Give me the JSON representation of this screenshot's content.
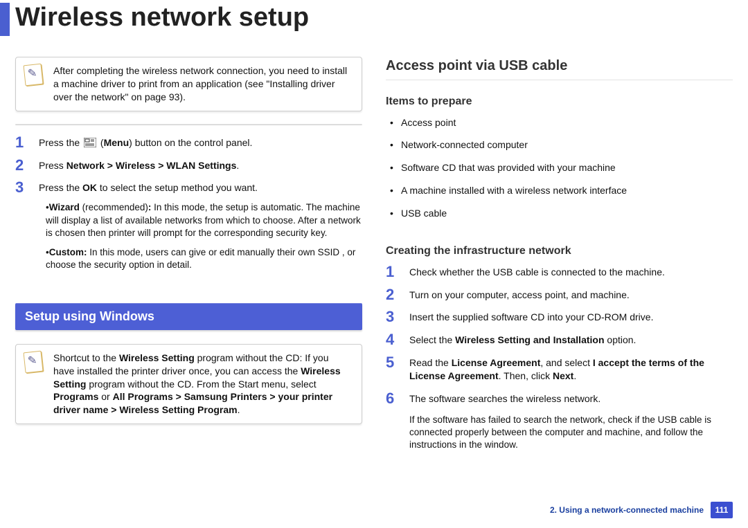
{
  "header": {
    "title": "Wireless network setup"
  },
  "left": {
    "note1": "After completing the wireless network connection, you need to install a machine driver to print from an application (see \"Installing driver over the network\" on page 93).",
    "steps": {
      "s1_a": "Press the ",
      "s1_b": " (",
      "s1_menu": "Menu",
      "s1_c": ") button on the control panel.",
      "s2_a": "Press ",
      "s2_path": "Network > Wireless > WLAN Settings",
      "s2_b": ".",
      "s3_a": "Press the ",
      "s3_ok": "OK",
      "s3_b": " to select the setup method you want.",
      "wizard_label": "Wizard",
      "wizard_rec": " (recommended)",
      "wizard_colon": ": ",
      "wizard_body": "In this mode, the setup is automatic. The machine will display a list of available networks from which to choose. After a network is chosen then printer will prompt for the corresponding security key.",
      "custom_label": "Custom:",
      "custom_body": " In this mode, users can give or edit manually their own SSID , or choose the security option in detail."
    },
    "section_bar": "Setup using Windows",
    "note2_a": "Shortcut to the ",
    "note2_ws1": "Wireless Setting",
    "note2_b": " program without the CD: If you have installed the printer driver once, you can access the ",
    "note2_ws2": "Wireless Setting",
    "note2_c": " program without the CD. From the Start menu, select ",
    "note2_programs": "Programs",
    "note2_or": " or ",
    "note2_allprograms": "All Programs",
    "note2_gt1": " > ",
    "note2_sp": "Samsung Printers",
    "note2_gt2": " > ",
    "note2_drv": "your printer driver name",
    "note2_gt3": " > ",
    "note2_wsp": "Wireless Setting Program",
    "note2_dot": "."
  },
  "right": {
    "h_access": "Access point via USB cable",
    "h_items": "Items to prepare",
    "items": [
      "Access point",
      "Network-connected computer",
      "Software CD that was provided with your machine",
      "A machine installed with a wireless network interface",
      "USB cable"
    ],
    "h_create": "Creating the infrastructure network",
    "csteps": {
      "c1": "Check whether the USB cable is connected to the machine.",
      "c2": "Turn on your computer, access point, and machine.",
      "c3": "Insert the supplied software CD into your CD-ROM drive.",
      "c4_a": "Select the ",
      "c4_b": "Wireless Setting and Installation",
      "c4_c": " option.",
      "c5_a": "Read the ",
      "c5_la1": "License Agreement",
      "c5_b": ", and select ",
      "c5_accept": "I accept the terms of the License Agreement",
      "c5_c": ". Then, click ",
      "c5_next": "Next",
      "c5_d": ".",
      "c6": "The software searches the wireless network.",
      "c6_note": "If the software has failed to search the network, check if the USB cable is connected properly between the computer and machine, and follow the instructions in the window."
    }
  },
  "footer": {
    "chapter": "2.  Using a network-connected machine",
    "page": "111"
  }
}
